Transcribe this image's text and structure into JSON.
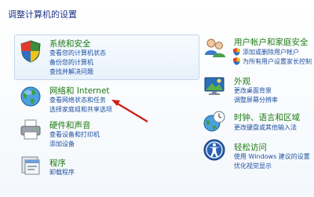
{
  "page": {
    "title": "调整计算机的设置"
  },
  "left": {
    "system": {
      "title": "系统和安全",
      "links": [
        "查看您的计算机状态",
        "备份您的计算机",
        "查找并解决问题"
      ]
    },
    "network": {
      "title": "网络和 Internet",
      "links": [
        "查看网络状态和任务",
        "选择家庭组和共享选项"
      ]
    },
    "hardware": {
      "title": "硬件和声音",
      "links": [
        "查看设备和打印机",
        "添加设备"
      ]
    },
    "programs": {
      "title": "程序",
      "links": [
        "卸载程序"
      ]
    }
  },
  "right": {
    "users": {
      "title": "用户帐户和家庭安全",
      "links": [
        "添加或删除用户帐户",
        "为所有用户设置家长控制"
      ]
    },
    "appearance": {
      "title": "外观",
      "links": [
        "更改桌面背景",
        "调整屏幕分辨率"
      ]
    },
    "clock": {
      "title": "时钟、语言和区域",
      "links": [
        "更改键盘或其他输入法"
      ]
    },
    "access": {
      "title": "轻松访问",
      "links": [
        "使用 Windows 建议的设置",
        "优化视觉显示"
      ]
    }
  },
  "colors": {
    "title_green": "#1e7b14",
    "link_blue": "#1e4fa0",
    "arrow_red": "#d11a1a"
  }
}
